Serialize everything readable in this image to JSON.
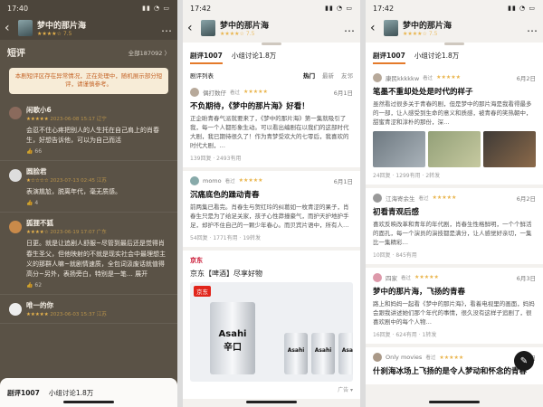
{
  "app": {
    "title": "梦中的那片海",
    "score": "7.5",
    "more": "…"
  },
  "screens": [
    {
      "time": "17:40",
      "section_title": "短评",
      "all_count": "全部187092 〉",
      "notice": "本剧短评区存在异常情况，正在处理中，随机展示部分短评，请谨慎参考。",
      "reviews": [
        {
          "user": "闲歌小6",
          "meta": "2023-06-08 15:17 辽宁",
          "text": "会忍不住心疼把别人的人生托在自己肩上的肖春生，好想告诉他，可以为自己而活",
          "likes": "66"
        },
        {
          "user": "圆脸君",
          "meta": "2023-07-13 02:45 江苏",
          "text": "表演尴尬，脱离年代，毫无质感。",
          "likes": "4"
        },
        {
          "user": "狐狸不狐",
          "meta": "2023-06-19 17:07 广东",
          "text": "日更。就是让追剧人舒服~尽管到最后还是觉得肖春生圣父，但他映射的不就是现实社会中最理想主义的那群人嘛~就剧情速质，全包词汲废话就值得高分~另外，表扬旁白，特别是一笔…",
          "more": "展开",
          "likes": "62"
        },
        {
          "user": "唯一的你",
          "meta": "2023-06-03 15:37 江苏",
          "text": "",
          "likes": ""
        }
      ],
      "bottom_tabs": [
        "剧评1007",
        "小组讨论1.8万"
      ]
    },
    {
      "time": "17:42",
      "tabs": [
        "剧评1007",
        "小组讨论1.8万"
      ],
      "list_label": "剧评列表",
      "segments": [
        "热门",
        "最新",
        "友邻"
      ],
      "cards": [
        {
          "user": "偶打数仔",
          "badge": "看过",
          "date": "6月1日",
          "title": "不负期待，《梦中的那片海》好看！",
          "body": "正企盼青春气派就要来了，《梦中的那片海》第一集就吸引了我，每一个人都形象生动。可以看出编剧在以我们的这部时代大剧，我已期待很久了！作为青梦受欢大的七零后，我喜欢的时代大剧，…",
          "foot": "139回复 · 2493有用"
        },
        {
          "user": "momo",
          "badge": "看过",
          "date": "6月1日",
          "title": "沉痛底色的躁动青春",
          "body": "前两集已看完。肖春生与贺红玲的纠葛如一枚青涩的果子，肖春生只是为了给足关家，孩子心性莽撞豪气，而护天护地护手足，却护不住自己的一颗少年春心。而贝宾片语中，所有人…",
          "foot": "54回复 · 1771有用 · 19转发"
        }
      ],
      "ad": {
        "tag": "京东",
        "title": "京东【啤酒】尽享好物",
        "badge": "京东",
        "brand": "Asahi",
        "sub": "辛口",
        "footer": "广告 ▾"
      }
    },
    {
      "time": "17:42",
      "tabs": [
        "剧评1007",
        "小组讨论1.8万"
      ],
      "cards": [
        {
          "user": "康民kkkkkw",
          "badge": "看过",
          "date": "6月2日",
          "title": "笔墨不重却处处是时代的样子",
          "body": "虽然看过很多关于青春的剧，但是梦中的那片海是我看得最多的一部，让人感受到生命的意义和质感，被青春的笑热朝中，甜蜜青涩和淳朴的那份，深…",
          "foot": "24回复 · 1299有用 · 2转发",
          "thumbs": true
        },
        {
          "user": "江海寄余生",
          "badge": "看过",
          "date": "6月2日",
          "title": "初看青观后感",
          "body": "喜欢反映改革和青年的年代剧，肖春生性格鲜明，一个个鲜活的面孔，每一个演员的演技都是满分，让人感觉好亲切，一集比一集精彩…",
          "foot": "10回复 · 845有用"
        },
        {
          "user": "四家",
          "badge": "看过",
          "date": "6月3日",
          "title": "梦中的那片海，飞扬的青春",
          "body": "路上和妈妈一起看《梦中的那片海》，看着电视里的画面，妈妈会跟我讲述她们那个年代的事情，很久没有这样子追剧了，很喜欢剧中的每个人物…",
          "foot": "16回复 · 624有用 · 1转发"
        },
        {
          "user": "Only movies",
          "badge": "看过",
          "date": "6月1日",
          "title": "什刹海冰场上飞扬的是令人梦动和怀念的青春",
          "body": "",
          "foot": ""
        }
      ],
      "fab": "✎"
    }
  ]
}
